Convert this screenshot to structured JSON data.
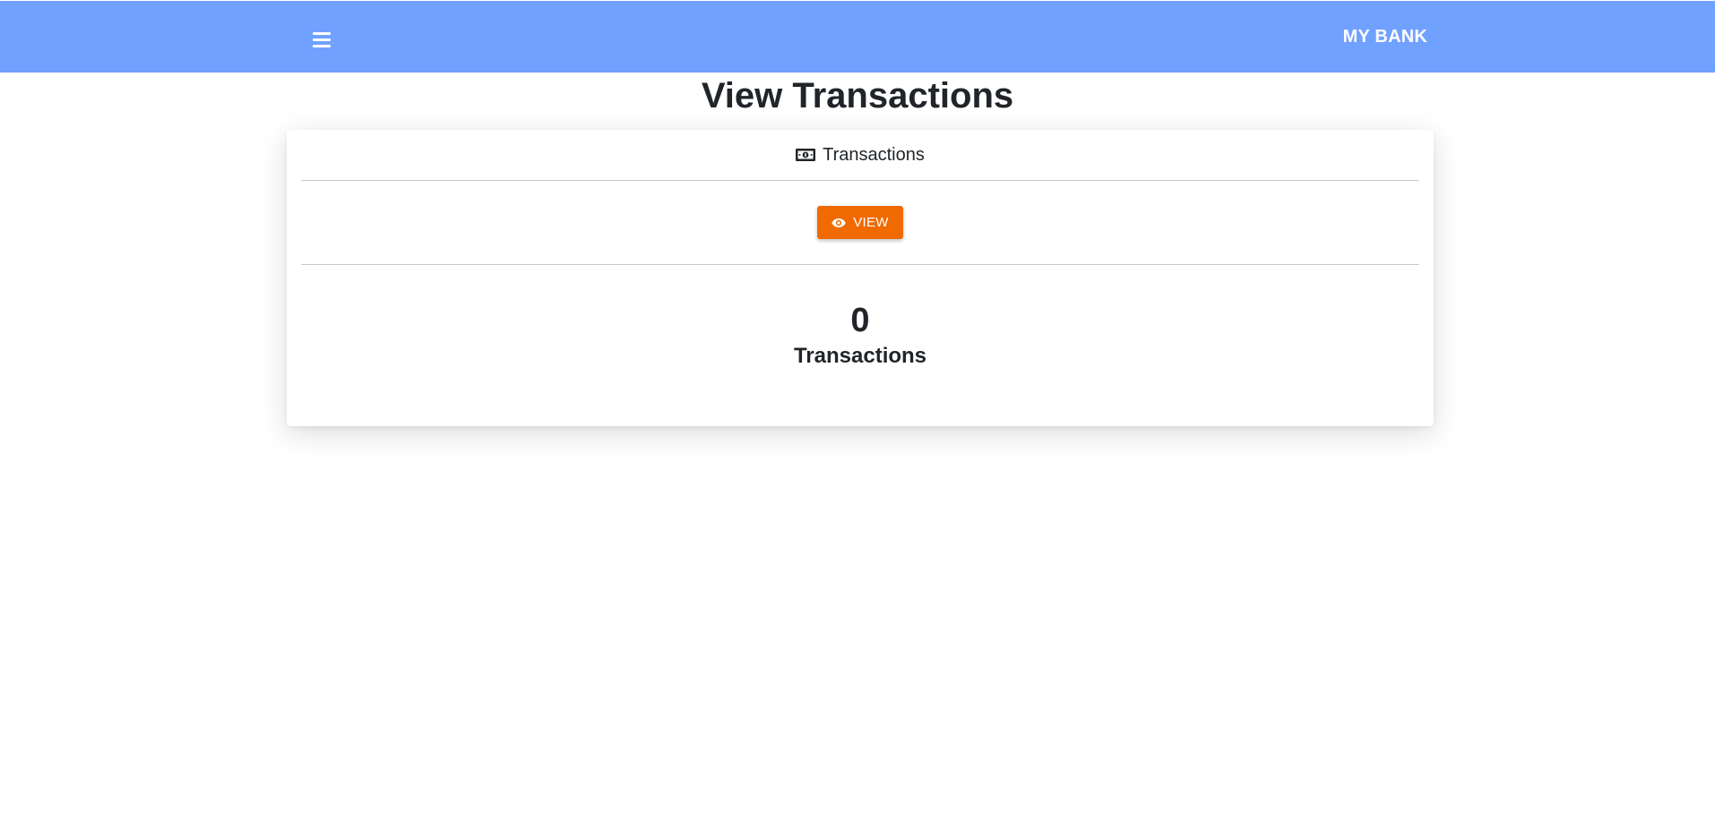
{
  "navbar": {
    "menu_icon": "hamburger-menu-icon",
    "brand": "MY BANK",
    "background": "#70a1ff"
  },
  "page": {
    "title": "View Transactions"
  },
  "card": {
    "header_icon": "money-bill-icon",
    "header_label": "Transactions",
    "view_button": {
      "icon": "eye-icon",
      "label": "VIEW",
      "color": "#f06a00"
    },
    "stat": {
      "value": "0",
      "label": "Transactions"
    }
  }
}
